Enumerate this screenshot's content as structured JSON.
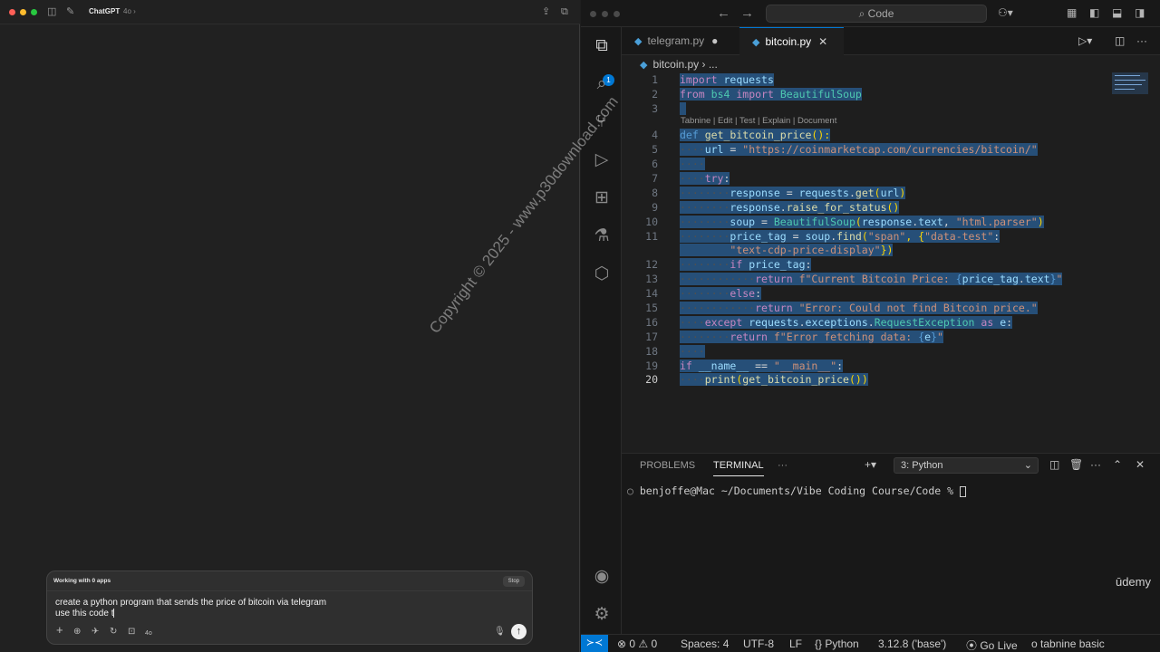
{
  "chat": {
    "app_name": "ChatGPT",
    "model": "4o ›",
    "icons": [
      "sidebar-icon",
      "new-chat-icon",
      "share-icon",
      "window-icon"
    ],
    "working_label": "Working with 0 apps",
    "stop_label": "Stop",
    "prompt_line1": "create a python program that sends the price of bitcoin via telegram",
    "prompt_line2": "use this code t",
    "model_badge": "4o",
    "send_glyph": "↑"
  },
  "watermark": "Copyright © 2025 - www.p30download.com",
  "vscode": {
    "search_label": "⌕ Code",
    "tabs": [
      {
        "label": "telegram.py",
        "modified": true
      },
      {
        "label": "bitcoin.py",
        "active": true
      }
    ],
    "breadcrumb": "bitcoin.py › ...",
    "codelens": "Tabnine | Edit | Test | Explain | Document",
    "badge_count": "1",
    "line_numbers": [
      "1",
      "2",
      "3",
      "4",
      "5",
      "6",
      "7",
      "8",
      "9",
      "10",
      "11",
      "12",
      "13",
      "14",
      "15",
      "16",
      "17",
      "18",
      "19",
      "20"
    ],
    "code": {
      "l1": [
        "import",
        "requests"
      ],
      "l2": [
        "from",
        "bs4",
        "import",
        "BeautifulSoup"
      ],
      "l4": [
        "def",
        "get_bitcoin_price",
        "():"
      ],
      "l5": [
        "url",
        " = ",
        "\"https://coinmarketcap.com/currencies/bitcoin/\""
      ],
      "l7": [
        "try",
        ":"
      ],
      "l8": [
        "response",
        " = ",
        "requests",
        ".",
        "get",
        "(",
        "url",
        ")"
      ],
      "l9": [
        "response",
        ".",
        "raise_for_status",
        "()"
      ],
      "l10": [
        "soup",
        " = ",
        "BeautifulSoup",
        "(",
        "response",
        ".",
        "text",
        ", ",
        "\"html.parser\"",
        ")"
      ],
      "l11": [
        "price_tag",
        " = ",
        "soup",
        ".",
        "find",
        "(",
        "\"span\"",
        ", {",
        "\"data-test\"",
        ":"
      ],
      "l11b": [
        "\"text-cdp-price-display\"",
        "})"
      ],
      "l12": [
        "if",
        "price_tag",
        ":"
      ],
      "l13": [
        "return",
        "f\"Current Bitcoin Price: ",
        "{",
        "price_tag",
        ".",
        "text",
        "}",
        "\""
      ],
      "l14": [
        "else",
        ":"
      ],
      "l15": [
        "return",
        "\"Error: Could not find Bitcoin price.\""
      ],
      "l16": [
        "except",
        "requests",
        ".",
        "exceptions",
        ".",
        "RequestException",
        "as",
        "e",
        ":"
      ],
      "l17": [
        "return",
        "f\"Error fetching data: ",
        "{",
        "e",
        "}",
        "\""
      ],
      "l19": [
        "if",
        "__name__",
        " == ",
        "\"__main__\"",
        ":"
      ],
      "l20": [
        "print",
        "(",
        "get_bitcoin_price",
        "())"
      ]
    },
    "panel": {
      "tabs": [
        "PROBLEMS",
        "TERMINAL",
        "···"
      ],
      "terminal_select": "3: Python",
      "terminal_line": "benjoffe@Mac ~/Documents/Vibe Coding Course/Code % "
    },
    "udemy": "ūdemy",
    "status": {
      "errors": "⊗ 0 ⚠ 0",
      "spaces": "Spaces: 4",
      "encoding": "UTF-8",
      "eol": "LF",
      "language": "{} Python",
      "interpreter": "3.12.8 ('base')",
      "go_live": "Go Live",
      "tabnine": "tabnine basic"
    }
  }
}
